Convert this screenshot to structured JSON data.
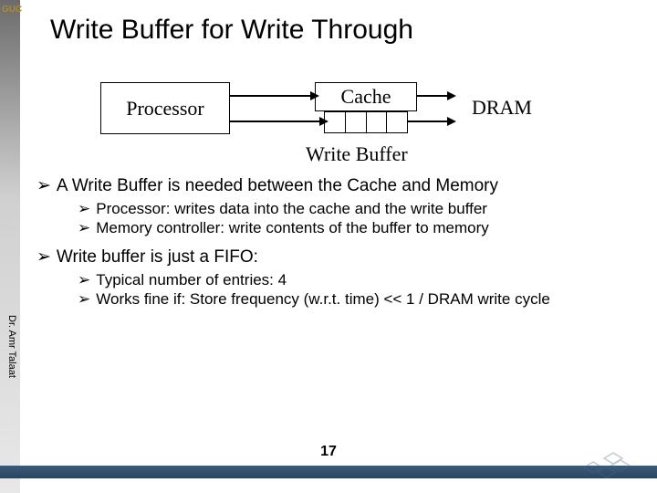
{
  "title": "Write Buffer for Write Through",
  "diagram": {
    "processor": "Processor",
    "cache": "Cache",
    "dram": "DRAM",
    "write_buffer_label": "Write Buffer",
    "write_buffer_entries": 4
  },
  "bullets": {
    "b1": "A Write Buffer is needed between the Cache and Memory",
    "b1a": "Processor: writes data into the cache and the write buffer",
    "b1b": "Memory controller: write contents of the buffer to memory",
    "b2": "Write buffer is just a FIFO:",
    "b2a": "Typical number of entries: 4",
    "b2b": "Works fine if:  Store frequency (w.r.t. time) << 1 / DRAM write cycle"
  },
  "author": "Dr. Amr Talaat",
  "page_number": "17",
  "logo_text": "GUC",
  "bullet_glyph": "➢"
}
